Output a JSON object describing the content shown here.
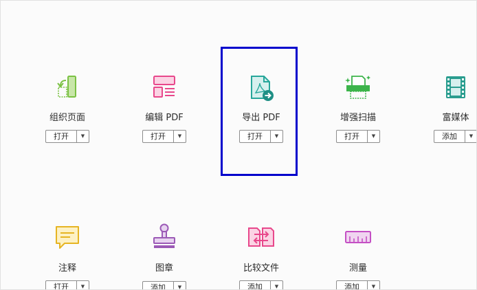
{
  "tools": [
    {
      "id": "organize",
      "label": "组织页面",
      "button": "打开",
      "icon": "organize-pages-icon",
      "color": "#7ac143"
    },
    {
      "id": "edit",
      "label": "编辑 PDF",
      "button": "打开",
      "icon": "edit-pdf-icon",
      "color": "#e8478b"
    },
    {
      "id": "export",
      "label": "导出 PDF",
      "button": "打开",
      "icon": "export-pdf-icon",
      "color": "#26a69a"
    },
    {
      "id": "scan",
      "label": "增强扫描",
      "button": "打开",
      "icon": "enhance-scan-icon",
      "color": "#3cb44b"
    },
    {
      "id": "rich",
      "label": "富媒体",
      "button": "添加",
      "icon": "rich-media-icon",
      "color": "#2a9d8f"
    },
    {
      "id": "comment",
      "label": "注释",
      "button": "打开",
      "icon": "comment-icon",
      "color": "#e6b422"
    },
    {
      "id": "stamp",
      "label": "图章",
      "button": "添加",
      "icon": "stamp-icon",
      "color": "#9b59b6"
    },
    {
      "id": "compare",
      "label": "比较文件",
      "button": "添加",
      "icon": "compare-files-icon",
      "color": "#e8478b"
    },
    {
      "id": "measure",
      "label": "测量",
      "button": "添加",
      "icon": "measure-icon",
      "color": "#c44fc4"
    }
  ],
  "dropdown_glyph": "▼",
  "selected_tool": "export"
}
